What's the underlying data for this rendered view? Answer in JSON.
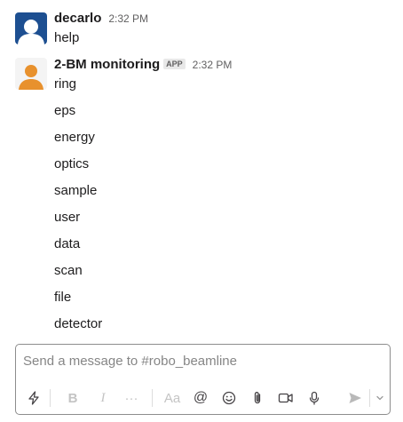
{
  "messages": [
    {
      "sender": "decarlo",
      "time": "2:32 PM",
      "text": "help",
      "avatar_color": "#1d4f91"
    },
    {
      "sender": "2-BM monitoring",
      "badge": "APP",
      "time": "2:32 PM",
      "avatar_color": "#e8912d",
      "items": [
        "ring",
        "eps",
        "energy",
        "optics",
        "sample",
        "user",
        "data",
        "scan",
        "file",
        "detector"
      ]
    }
  ],
  "composer": {
    "placeholder": "Send a message to #robo_beamline",
    "toolbar": {
      "bold_label": "B",
      "italic_label": "I",
      "more_label": "···",
      "text_format_label": "Aa",
      "mention_label": "@"
    },
    "icons": [
      "shortcuts-icon",
      "bold-icon",
      "italic-icon",
      "more-formatting-icon",
      "text-format-icon",
      "mention-icon",
      "emoji-icon",
      "attach-icon",
      "video-icon",
      "microphone-icon",
      "send-icon",
      "send-options-chevron-icon"
    ]
  },
  "colors": {
    "text": "#1d1c1d",
    "muted": "#616061",
    "border": "#8d8d8d"
  }
}
